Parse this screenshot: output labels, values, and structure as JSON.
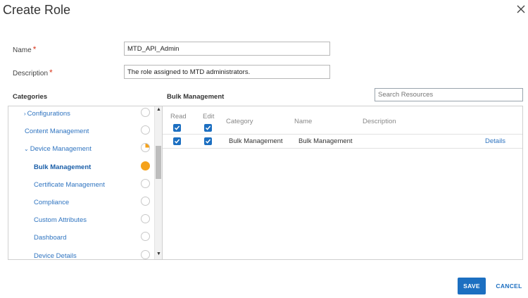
{
  "dialog": {
    "title": "Create Role",
    "close_icon": "close-icon"
  },
  "form": {
    "name_label": "Name",
    "name_value": "MTD_API_Admin",
    "description_label": "Description",
    "description_value": "The role assigned to MTD administrators.",
    "required_mark": "*"
  },
  "categories": {
    "heading": "Categories",
    "items": [
      {
        "label": "Configurations",
        "level": 0,
        "chevron": "›",
        "state": "empty"
      },
      {
        "label": "Content Management",
        "level": 0,
        "chevron": "",
        "state": "empty"
      },
      {
        "label": "Device Management",
        "level": 0,
        "chevron": "⌄",
        "state": "partial"
      },
      {
        "label": "Bulk Management",
        "level": 1,
        "chevron": "",
        "state": "full",
        "active": true
      },
      {
        "label": "Certificate Management",
        "level": 1,
        "chevron": "",
        "state": "empty"
      },
      {
        "label": "Compliance",
        "level": 1,
        "chevron": "",
        "state": "empty"
      },
      {
        "label": "Custom Attributes",
        "level": 1,
        "chevron": "",
        "state": "empty"
      },
      {
        "label": "Dashboard",
        "level": 1,
        "chevron": "",
        "state": "empty"
      },
      {
        "label": "Device Details",
        "level": 1,
        "chevron": "",
        "state": "empty"
      }
    ]
  },
  "resources": {
    "heading": "Bulk Management",
    "search_placeholder": "Search Resources",
    "columns": {
      "read": "Read",
      "edit": "Edit",
      "category": "Category",
      "name": "Name",
      "description": "Description"
    },
    "rows": [
      {
        "read": true,
        "edit": true,
        "category": "Bulk Management",
        "name": "Bulk Management",
        "description": "",
        "action": "Details"
      }
    ]
  },
  "footer": {
    "save_label": "SAVE",
    "cancel_label": "CANCEL"
  },
  "colors": {
    "accent": "#1c6fc1",
    "link": "#2f74c0",
    "required": "#d9381e",
    "status_orange": "#f5a21b"
  }
}
